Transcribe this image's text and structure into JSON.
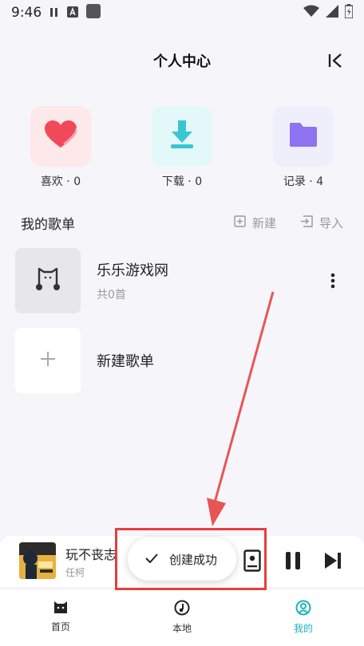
{
  "status_bar": {
    "time": "9:46"
  },
  "header": {
    "title": "个人中心"
  },
  "shortcuts": [
    {
      "label": "喜欢 · 0",
      "icon": "heart-icon",
      "color": "#f04a5a"
    },
    {
      "label": "下载 · 0",
      "icon": "download-icon",
      "color": "#38c6d2"
    },
    {
      "label": "记录 · 4",
      "icon": "folder-icon",
      "color": "#8e72f0"
    }
  ],
  "playlists_section": {
    "title": "我的歌单",
    "new_label": "新建",
    "import_label": "导入"
  },
  "playlists": [
    {
      "name": "乐乐游戏网",
      "count": "共0首"
    },
    {
      "name": "新建歌单"
    }
  ],
  "player": {
    "song_title": "玩不丧志",
    "artist": "任柯"
  },
  "toast": {
    "message": "创建成功"
  },
  "nav": [
    {
      "label": "首页",
      "icon": "cat-icon"
    },
    {
      "label": "本地",
      "icon": "music-note-icon"
    },
    {
      "label": "我的",
      "icon": "user-circle-icon",
      "active": true
    }
  ],
  "colors": {
    "accent": "#1ab3c1",
    "highlight": "#e63e3e",
    "background": "#f6f6fa"
  }
}
